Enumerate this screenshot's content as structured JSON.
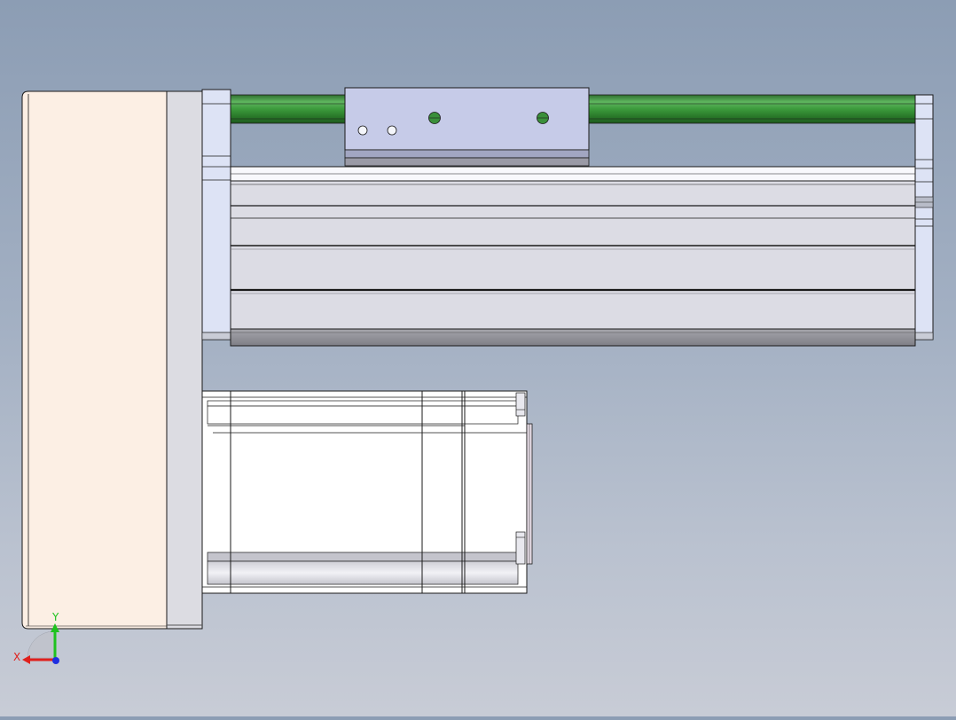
{
  "triad": {
    "x_label": "X",
    "y_label": "Y",
    "x_color": "#e0201c",
    "y_color": "#1fc21f",
    "z_color": "#1f2fe0"
  },
  "colors": {
    "background_top": "#8c9db4",
    "background_bottom": "#c8ccd6",
    "guide_rod": "#3a8f3a",
    "carriage": "#c6cbe8",
    "rail_body": "#dcdce4",
    "end_plate": "#dde3f5",
    "motor_cover": "#fcefe4",
    "outline": "#1a1a1a"
  }
}
